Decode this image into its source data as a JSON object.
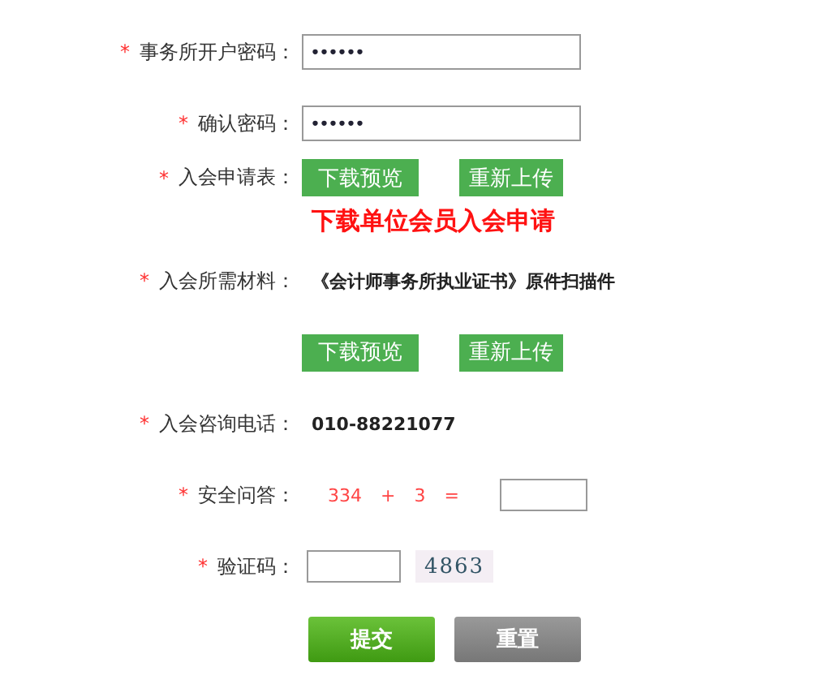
{
  "password": {
    "label": "事务所开户密码：",
    "value": "••••••"
  },
  "confirm_password": {
    "label": "确认密码：",
    "value": "••••••"
  },
  "application_form": {
    "label": "入会申请表：",
    "buttons": [
      "下载预览",
      "重新上传"
    ],
    "link": "下载单位会员入会申请"
  },
  "materials": {
    "label": "入会所需材料：",
    "text": "《会计师事务所执业证书》原件扫描件",
    "buttons": [
      "下载预览",
      "重新上传"
    ]
  },
  "phone": {
    "label": "入会咨询电话：",
    "value": "010-88221077"
  },
  "security_question": {
    "label": "安全问答：",
    "question": "334 + 3 ="
  },
  "captcha": {
    "label": "验证码：",
    "code": "4863"
  },
  "actions": {
    "submit": "提交",
    "reset": "重置"
  },
  "required_mark": "*"
}
